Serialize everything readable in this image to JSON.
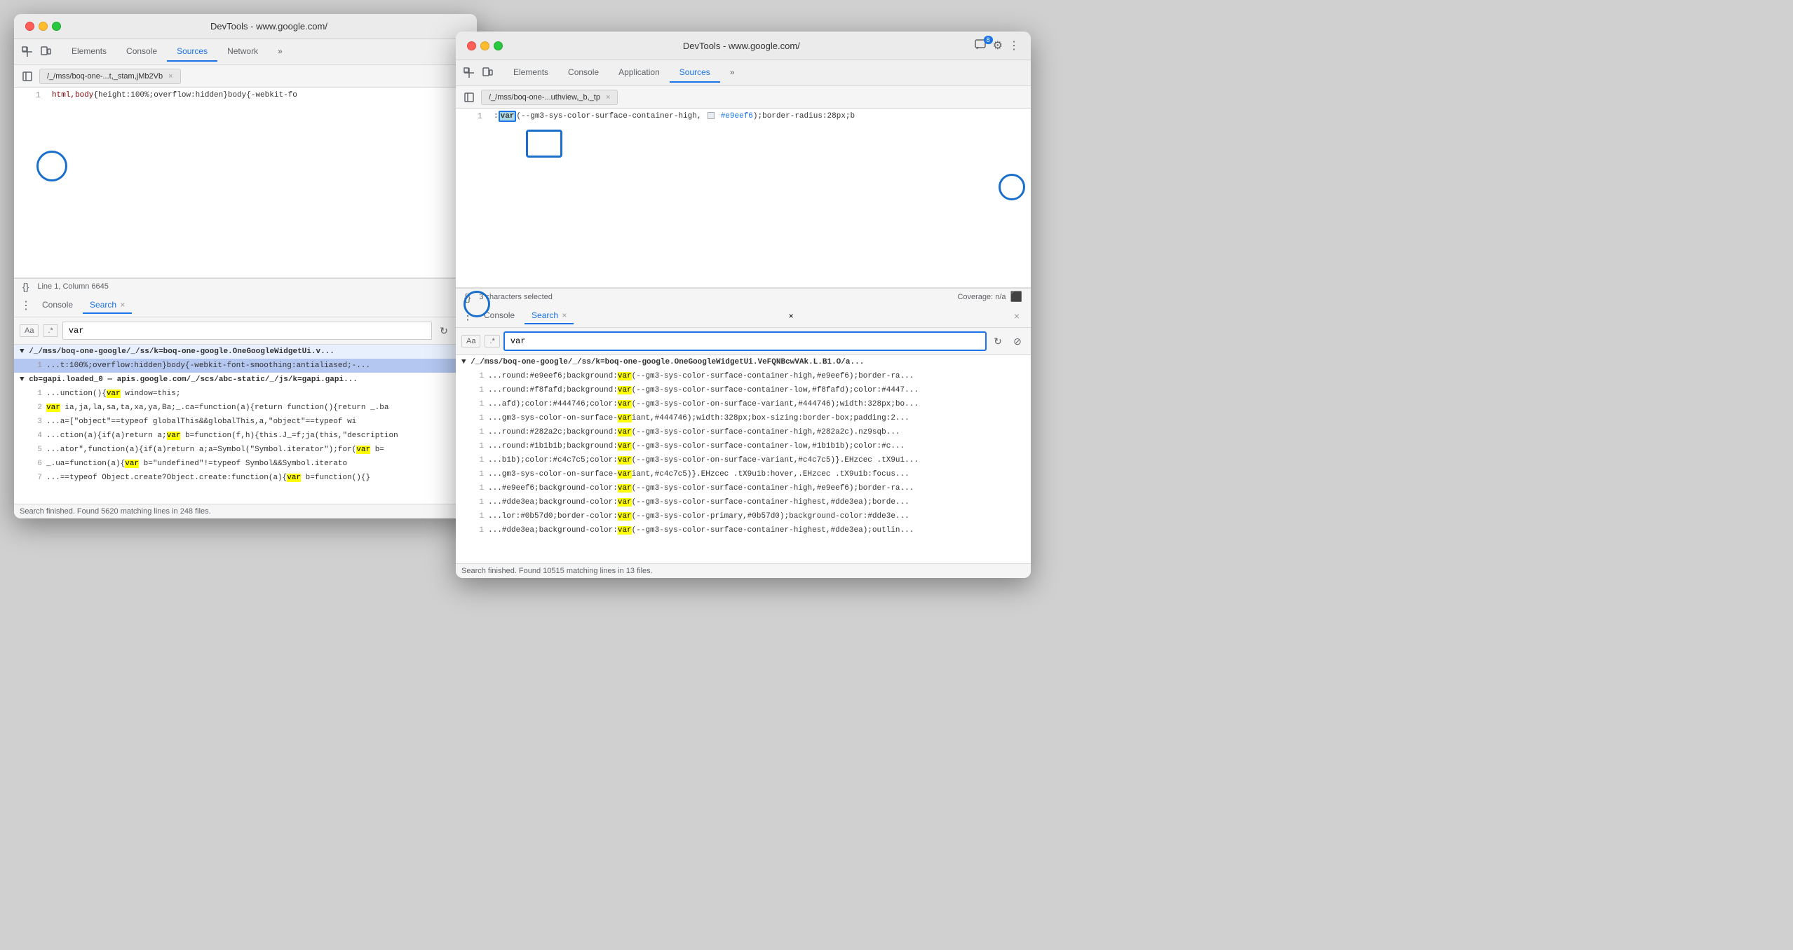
{
  "window_left": {
    "title": "DevTools - www.google.com/",
    "toolbar": {
      "tabs": [
        "Elements",
        "Console",
        "Sources",
        "Network"
      ],
      "active_tab": "Sources",
      "more_label": "»"
    },
    "file_tab": {
      "name": "/_/mss/boq-one-...t,_stam,jMb2Vb",
      "close_label": "×"
    },
    "code": {
      "line_number": "1",
      "content": "html,body{height:100%;overflow:hidden}body{-webkit-fo"
    },
    "status_bar": {
      "line_col": "Line 1, Column 6645"
    },
    "bottom_panel": {
      "tabs": [
        "Console",
        "Search"
      ],
      "active_tab": "Search",
      "close_label": "×",
      "search": {
        "aa_label": "Aa",
        "regex_label": ".*",
        "placeholder": "var",
        "value": "var"
      },
      "results": [
        {
          "file": "▼ /_/mss/boq-one-google/_/ss/k=boq-one-google.OneGoogleWidgetUi.v...",
          "selected": true,
          "rows": [
            {
              "num": "1",
              "text": "...t:100%;overflow:hidden}body{-webkit-font-smoothing:antialiased;-..."
            }
          ]
        },
        {
          "file": "▼ cb=gapi.loaded_0  —  apis.google.com/_/scs/abc-static/_/js/k=gapi.gapi...",
          "selected": false,
          "rows": [
            {
              "num": "1",
              "text": "...unction(){var window=this;"
            },
            {
              "num": "2",
              "text": "var ia,ja,la,sa,ta,xa,ya,Ba;_.ca=function(a){return function(){return _.ba"
            },
            {
              "num": "3",
              "text": "...a=[\"object\"==typeof globalThis&&globalThis,a,\"object\"==typeof wi"
            },
            {
              "num": "4",
              "text": "...ction(a){if(a)return a;var b=function(f,h){this.J_=f;ja(this,\"description"
            },
            {
              "num": "5",
              "text": "...ator\",function(a){if(a)return a;a=Symbol(\"Symbol.iterator\");for(var b="
            },
            {
              "num": "6",
              "text": "_.ua=function(a){var b=\"undefined\"!=typeof Symbol&&Symbol.iterato"
            },
            {
              "num": "7",
              "text": "...==typeof Object.create?Object.create:function(a){var b=function(){}"
            }
          ]
        }
      ],
      "footer": "Search finished.  Found 5620 matching lines in 248 files."
    }
  },
  "window_right": {
    "title": "DevTools - www.google.com/",
    "toolbar": {
      "tabs": [
        "Elements",
        "Console",
        "Application",
        "Sources"
      ],
      "active_tab": "Sources",
      "more_label": "»",
      "badge": "8"
    },
    "file_tab": {
      "name": "/_/mss/boq-one-...uthview,_b,_tp",
      "close_label": "×"
    },
    "code": {
      "line_number": "1",
      "content": ":var(--gm3-sys-color-surface-container-high,",
      "color_swatch": "#e9eef6",
      "content2": "#e9eef6);border-radius:28px;b"
    },
    "status_bar": {
      "chars_selected": "3 characters selected",
      "coverage": "Coverage: n/a"
    },
    "bottom_panel": {
      "tabs": [
        "Console",
        "Search"
      ],
      "active_tab": "Search",
      "close_label": "×",
      "close_panel_label": "×",
      "search": {
        "aa_label": "Aa",
        "regex_label": ".*",
        "placeholder": "var",
        "value": "var"
      },
      "results_file": "▼ /_/mss/boq-one-google/_/ss/k=boq-one-google.OneGoogleWidgetUi.VeFQNBcwVAk.L.B1.O/a...",
      "rows": [
        {
          "num": "1",
          "text": "...round:#e9eef6;background:var(--gm3-sys-color-surface-container-high,#e9eef6);border-ra..."
        },
        {
          "num": "1",
          "text": "...round:#f8fafd;background:var(--gm3-sys-color-surface-container-low,#f8fafd);color:#4447..."
        },
        {
          "num": "1",
          "text": "...afd);color:#444746;color:var(--gm3-sys-color-on-surface-variant,#444746);width:328px;bo..."
        },
        {
          "num": "1",
          "text": "...gm3-sys-color-on-surface-variant,#444746);width:328px;box-sizing:border-box;padding:2..."
        },
        {
          "num": "1",
          "text": "...round:#282a2c;background:var(--gm3-sys-color-surface-container-high,#282a2c).nz9sqb..."
        },
        {
          "num": "1",
          "text": "...round:#1b1b1b;background:var(--gm3-sys-color-surface-container-low,#1b1b1b);color:#c..."
        },
        {
          "num": "1",
          "text": "...b1b);color:#c4c7c5;color:var(--gm3-sys-color-on-surface-variant,#c4c7c5)}.EHzcec .tX9u1..."
        },
        {
          "num": "1",
          "text": "...gm3-sys-color-on-surface-variant,#c4c7c5)}.EHzcec .tX9u1b:hover,.EHzcec .tX9u1b:focus..."
        },
        {
          "num": "1",
          "text": "...#e9eef6;background-color:var(--gm3-sys-color-surface-container-high,#e9eef6);border-ra..."
        },
        {
          "num": "1",
          "text": "...#dde3ea;background-color:var(--gm3-sys-color-surface-container-highest,#dde3ea);borde..."
        },
        {
          "num": "1",
          "text": "...lor:#0b57d0;border-color:var(--gm3-sys-color-primary,#0b57d0);background-color:#dde3e..."
        },
        {
          "num": "1",
          "text": "...#dde3ea;background-color:var(--gm3-sys-color-surface-container-highest,#dde3ea);outlin..."
        }
      ],
      "footer": "Search finished.  Found 10515 matching lines in 13 files."
    }
  },
  "icons": {
    "more_tools": "⋮",
    "inspect": "⬚",
    "device": "⬛",
    "close": "×",
    "refresh": "↻",
    "clear": "⊘",
    "triangle_right": "▶",
    "triangle_down": "▼",
    "chevron_left": "❮",
    "chevron_right": "❯"
  }
}
